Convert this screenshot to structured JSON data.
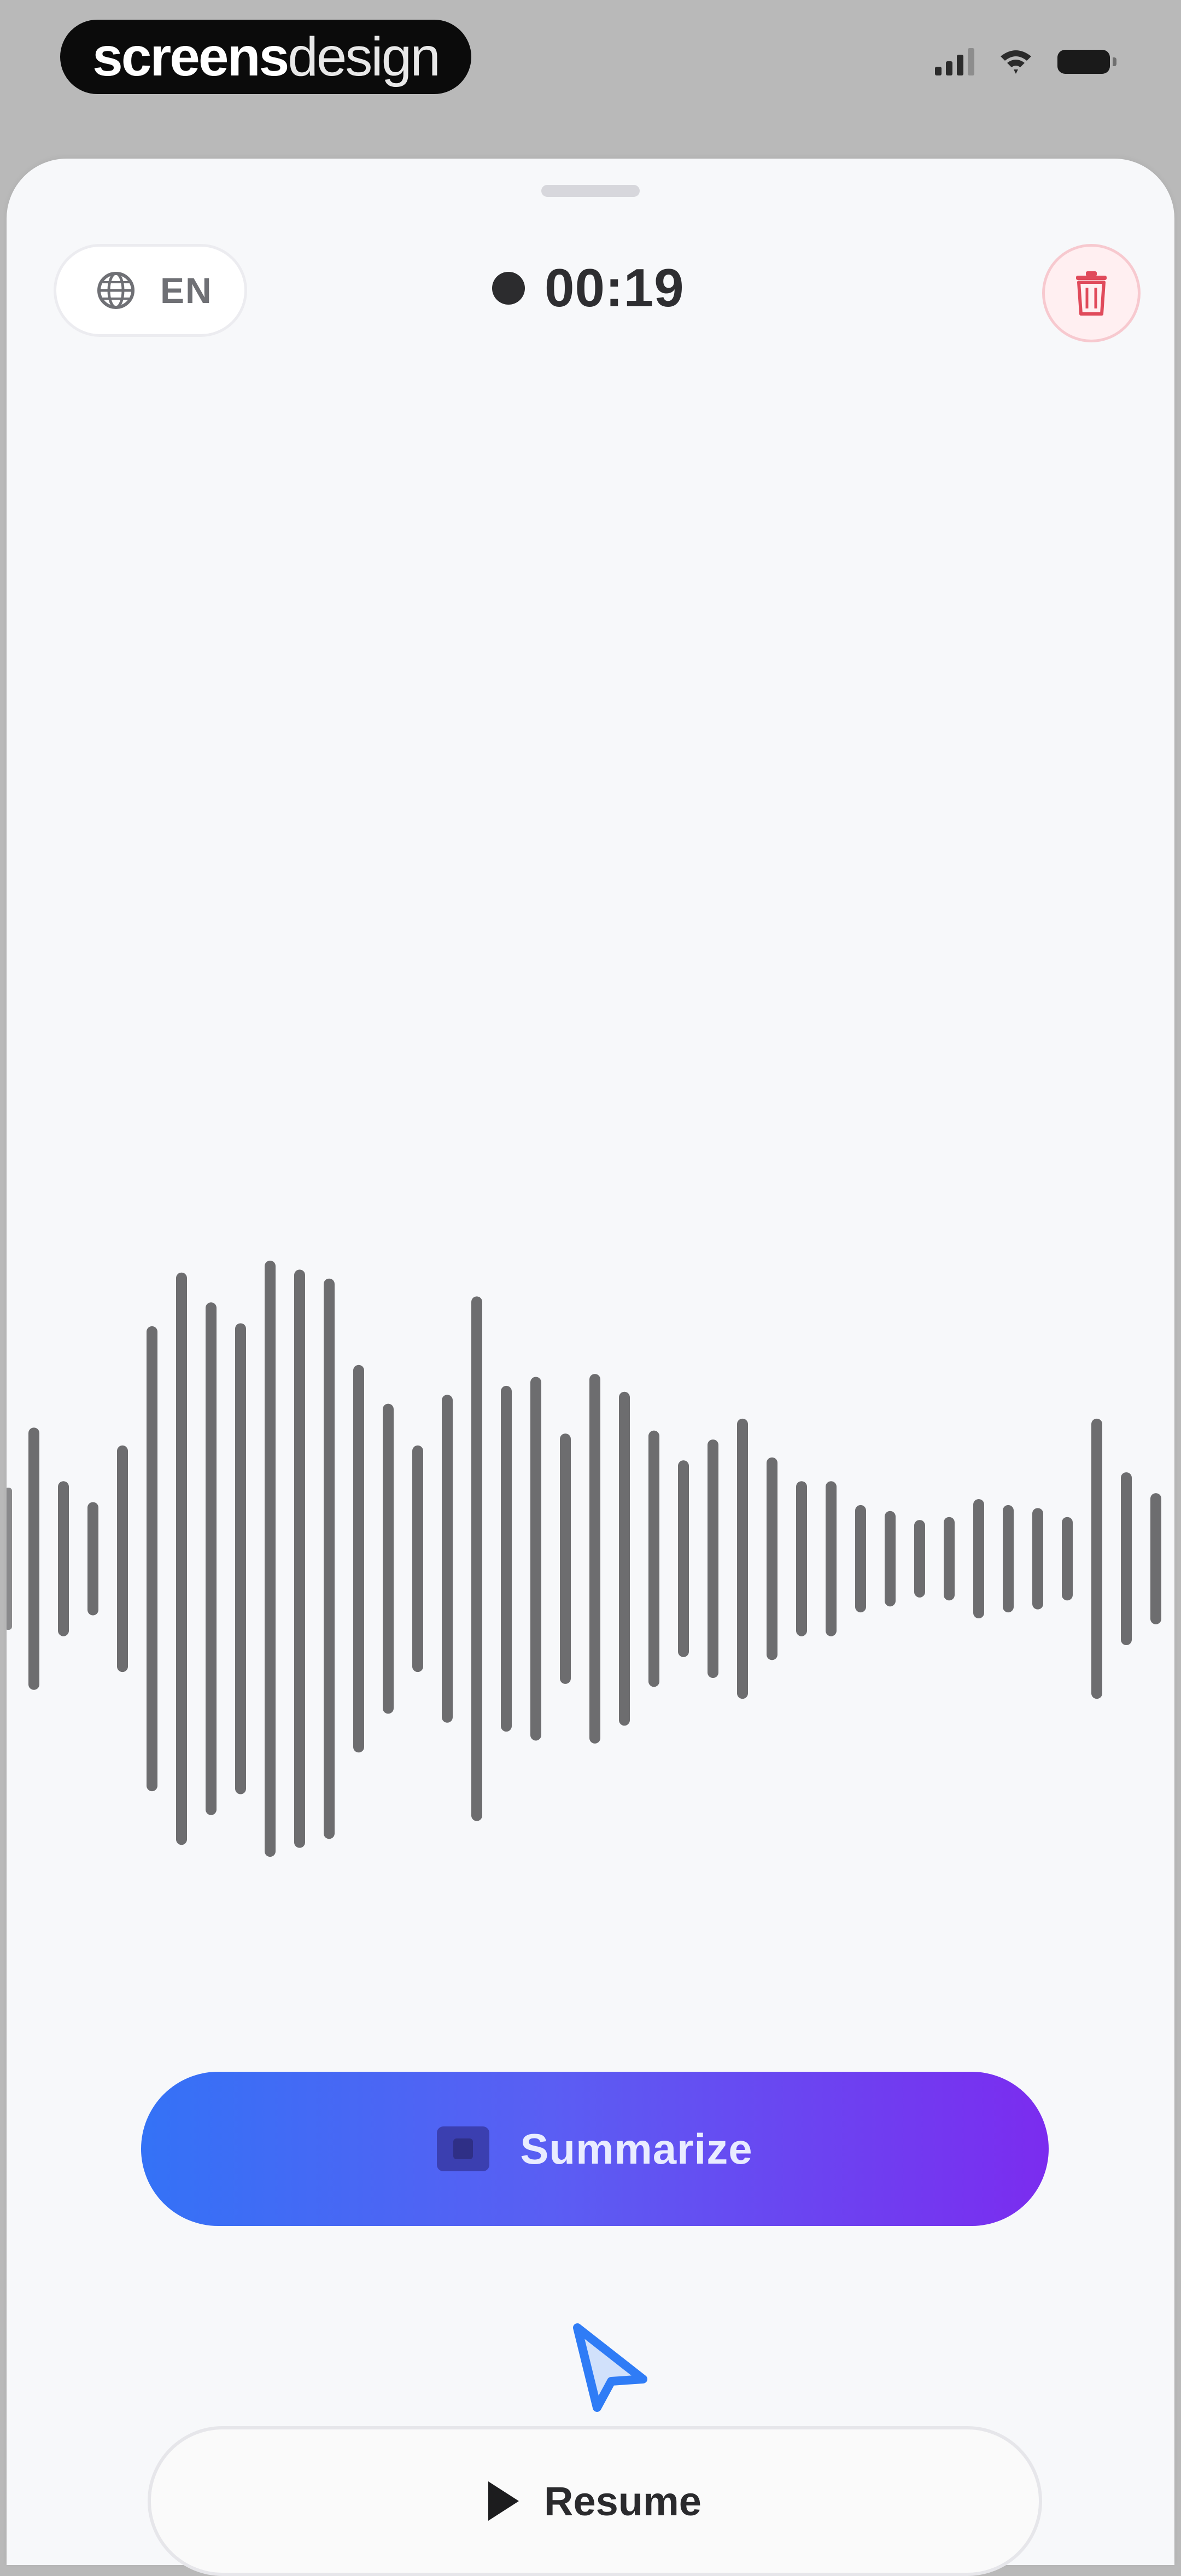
{
  "status_bar": {
    "brand_bold": "screens",
    "brand_light": "design",
    "icons": [
      "cellular-signal-icon",
      "wifi-icon",
      "battery-icon"
    ]
  },
  "recorder": {
    "language": "EN",
    "elapsed": "00:19",
    "icons": {
      "language": "globe-icon",
      "recording": "recording-dot-icon",
      "delete": "trash-icon"
    },
    "colors": {
      "delete_accent": "#e04a5b",
      "waveform_bar": "#6d6d6f"
    }
  },
  "actions": {
    "summarize_label": "Summarize",
    "resume_label": "Resume",
    "summarize_icon": "summary-icon",
    "resume_icon": "play-icon",
    "summarize_gradient": [
      "#3472f6",
      "#7b2cef"
    ]
  },
  "waveform": {
    "levels": [
      0.44,
      0.26,
      0.19,
      0.38,
      0.78,
      0.96,
      0.86,
      0.79,
      1.0,
      0.97,
      0.94,
      0.65,
      0.52,
      0.38,
      0.55,
      0.88,
      0.58,
      0.61,
      0.42,
      0.62,
      0.56,
      0.43,
      0.33,
      0.4,
      0.47,
      0.34,
      0.26,
      0.26,
      0.18,
      0.16,
      0.13,
      0.14,
      0.2,
      0.18,
      0.17,
      0.14,
      0.47,
      0.29,
      0.22,
      0.03,
      0.03
    ]
  }
}
